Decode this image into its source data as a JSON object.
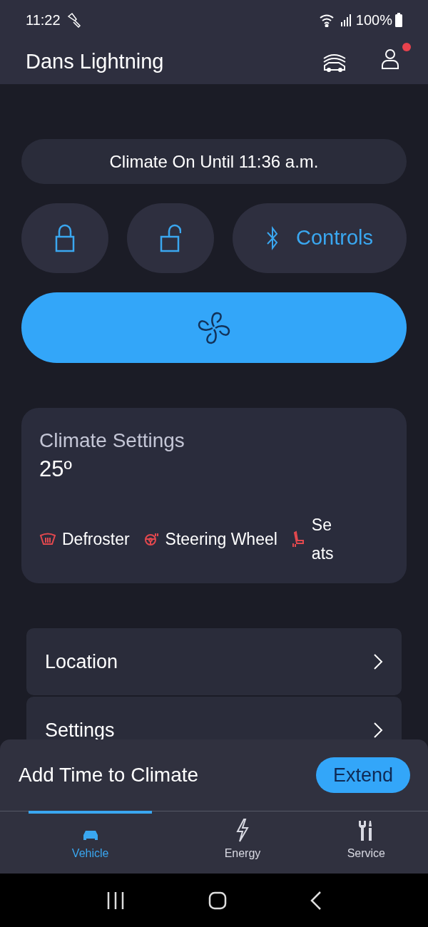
{
  "status_bar": {
    "time": "11:22",
    "battery": "100%"
  },
  "header": {
    "title": "Dans Lightning",
    "has_notification": true
  },
  "banner": "Climate On Until 11:36 a.m.",
  "quick_actions": [
    {
      "kind": "lock"
    },
    {
      "kind": "unlock"
    },
    {
      "kind": "controls",
      "label": "Controls"
    }
  ],
  "climate_button": {
    "on": true
  },
  "climate_card": {
    "title": "Climate Settings",
    "temperature": "25º",
    "features": [
      {
        "kind": "defroster",
        "label": "Defroster"
      },
      {
        "kind": "steering",
        "label": "Steering Wheel"
      },
      {
        "kind": "seats",
        "label": "Seats"
      }
    ]
  },
  "menu_items": [
    {
      "label": "Location"
    },
    {
      "label": "Settings"
    }
  ],
  "sheet": {
    "text": "Add Time to Climate",
    "button": "Extend"
  },
  "tabs": [
    {
      "kind": "vehicle",
      "label": "Vehicle",
      "selected": true
    },
    {
      "kind": "energy",
      "label": "Energy",
      "selected": false
    },
    {
      "kind": "service",
      "label": "Service",
      "selected": false
    }
  ]
}
